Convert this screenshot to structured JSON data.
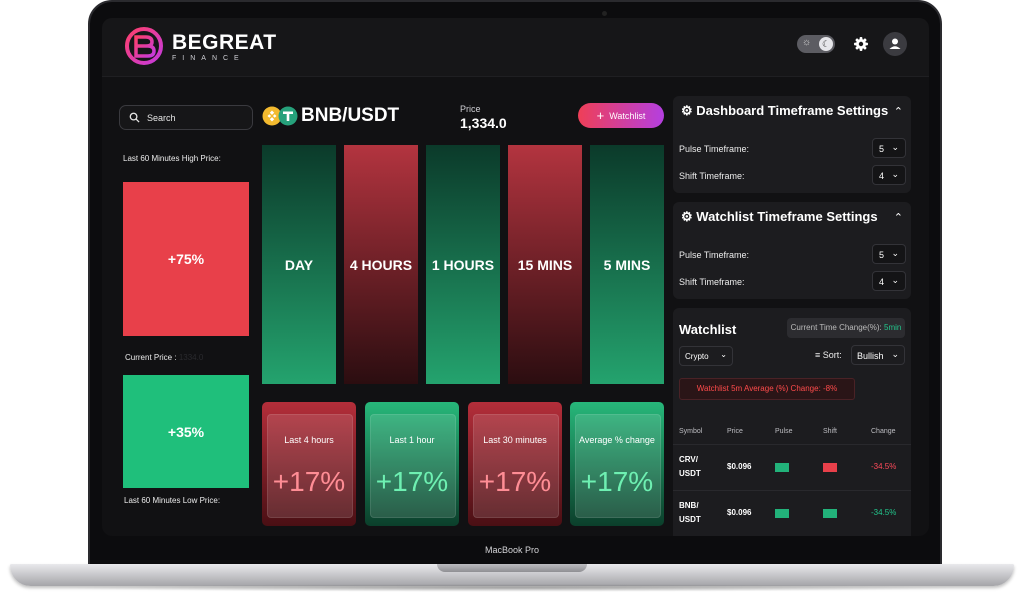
{
  "device": {
    "model_label": "MacBook Pro"
  },
  "brand": {
    "name": "BEGREAT",
    "sub": "FINANCE"
  },
  "colors": {
    "accent_red": "#e8404a",
    "accent_green": "#1fbf7b",
    "button_gradient_start": "#ef3f57",
    "button_gradient_end": "#b43fe0"
  },
  "search": {
    "placeholder": "Search"
  },
  "left": {
    "high_label": "Last 60 Minutes High Price:",
    "high_value": "+75%",
    "current_label": "Current Price :",
    "current_value": "1334.0",
    "low_value": "+35%",
    "low_label": "Last 60 Minutes Low Price:"
  },
  "pair": {
    "name": "BNB/USDT",
    "price_label": "Price",
    "price_value": "1,334.0"
  },
  "watchlist_button": "Watchlist",
  "timeframes": [
    {
      "label": "DAY",
      "trend": "up"
    },
    {
      "label": "4 HOURS",
      "trend": "down"
    },
    {
      "label": "1 HOURS",
      "trend": "up"
    },
    {
      "label": "15 MINS",
      "trend": "down"
    },
    {
      "label": "5 MINS",
      "trend": "up"
    }
  ],
  "changes": [
    {
      "label": "Last 4 hours",
      "value": "+17%",
      "trend": "down"
    },
    {
      "label": "Last 1 hour",
      "value": "+17%",
      "trend": "up"
    },
    {
      "label": "Last 30 minutes",
      "value": "+17%",
      "trend": "down"
    },
    {
      "label": "Average % change",
      "value": "+17%",
      "trend": "up"
    }
  ],
  "dashboard_settings": {
    "title": "Dashboard Timeframe Settings",
    "pulse_label": "Pulse Timeframe:",
    "pulse_value": "5",
    "shift_label": "Shift Timeframe:",
    "shift_value": "4"
  },
  "watchlist_settings": {
    "title": "Watchlist Timeframe Settings",
    "pulse_label": "Pulse Timeframe:",
    "pulse_value": "5",
    "shift_label": "Shift Timeframe:",
    "shift_value": "4"
  },
  "watchlist": {
    "title": "Watchlist",
    "time_change_label": "Current Time Change(%):",
    "time_change_value": "5min",
    "category": "Crypto",
    "sort_label": "Sort:",
    "sort_value": "Bullish",
    "average_alert": "Watchlist 5m Average (%) Change: -8%",
    "columns": [
      "Symbol",
      "Price",
      "Pulse",
      "Shift",
      "Change"
    ],
    "rows": [
      {
        "symbol_1": "CRV/",
        "symbol_2": "USDT",
        "price": "$0.096",
        "pulse": "up",
        "shift": "down",
        "change": "-34.5%",
        "change_color": "neg"
      },
      {
        "symbol_1": "BNB/",
        "symbol_2": "USDT",
        "price": "$0.096",
        "pulse": "up",
        "shift": "up",
        "change": "-34.5%",
        "change_color": "pos"
      }
    ]
  }
}
